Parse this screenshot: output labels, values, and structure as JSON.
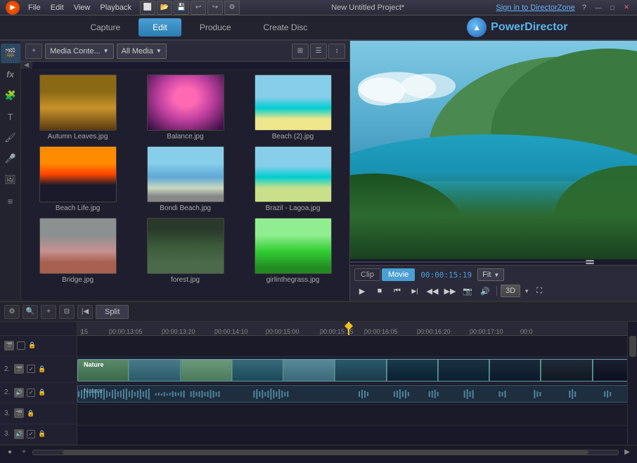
{
  "titlebar": {
    "app_name": "PowerDirector",
    "project_title": "New Untitled Project*",
    "sign_in": "Sign in to DirectorZone",
    "menu": [
      "File",
      "Edit",
      "View",
      "Playback"
    ]
  },
  "mode_tabs": {
    "capture": "Capture",
    "edit": "Edit",
    "produce": "Produce",
    "create_disc": "Create Disc"
  },
  "media_panel": {
    "media_content_label": "Media Conte...",
    "all_media_label": "All Media"
  },
  "media_items": [
    {
      "name": "Autumn Leaves.jpg",
      "thumb_class": "thumb-autumn"
    },
    {
      "name": "Balance.jpg",
      "thumb_class": "thumb-balance"
    },
    {
      "name": "Beach (2).jpg",
      "thumb_class": "thumb-beach2"
    },
    {
      "name": "Beach Life.jpg",
      "thumb_class": "thumb-beachlife"
    },
    {
      "name": "Bondi Beach.jpg",
      "thumb_class": "thumb-bondi"
    },
    {
      "name": "Brazil - Lagoa.jpg",
      "thumb_class": "thumb-brazil"
    },
    {
      "name": "Bridge.jpg",
      "thumb_class": "thumb-bridge"
    },
    {
      "name": "forest.jpg",
      "thumb_class": "thumb-forest"
    },
    {
      "name": "girlinthegrass.jpg",
      "thumb_class": "thumb-girl"
    }
  ],
  "playback": {
    "clip_label": "Clip",
    "movie_label": "Movie",
    "time": "00:00:15:19",
    "fit_label": "Fit",
    "three_d": "3D"
  },
  "timeline": {
    "split_label": "Split",
    "tracks": [
      {
        "id": 1,
        "type": "empty",
        "icons": [
          "film"
        ]
      },
      {
        "id": 2,
        "type": "video",
        "label": "Nature",
        "icons": [
          "film",
          "check",
          "lock"
        ]
      },
      {
        "id": 2,
        "type": "audio",
        "label": "Nature",
        "icons": [
          "audio",
          "check",
          "lock"
        ]
      },
      {
        "id": 3,
        "type": "empty",
        "icons": [
          "film",
          "lock"
        ]
      },
      {
        "id": 3,
        "type": "audio-empty",
        "icons": [
          "audio",
          "check",
          "lock"
        ]
      }
    ],
    "ruler_marks": [
      {
        "label": "15",
        "pos": 0
      },
      {
        "label": "00:00:13:05",
        "pos": 40
      },
      {
        "label": "00:00:13:20",
        "pos": 110
      },
      {
        "label": "00:00:14:10",
        "pos": 182
      },
      {
        "label": "00:00:15:00",
        "pos": 253
      },
      {
        "label": "00:00:15:15",
        "pos": 340
      },
      {
        "label": "00:00:16:05",
        "pos": 395
      },
      {
        "label": "00:00:16:20",
        "pos": 468
      },
      {
        "label": "00:00:17:10",
        "pos": 540
      },
      {
        "label": "00:0",
        "pos": 612
      }
    ]
  }
}
